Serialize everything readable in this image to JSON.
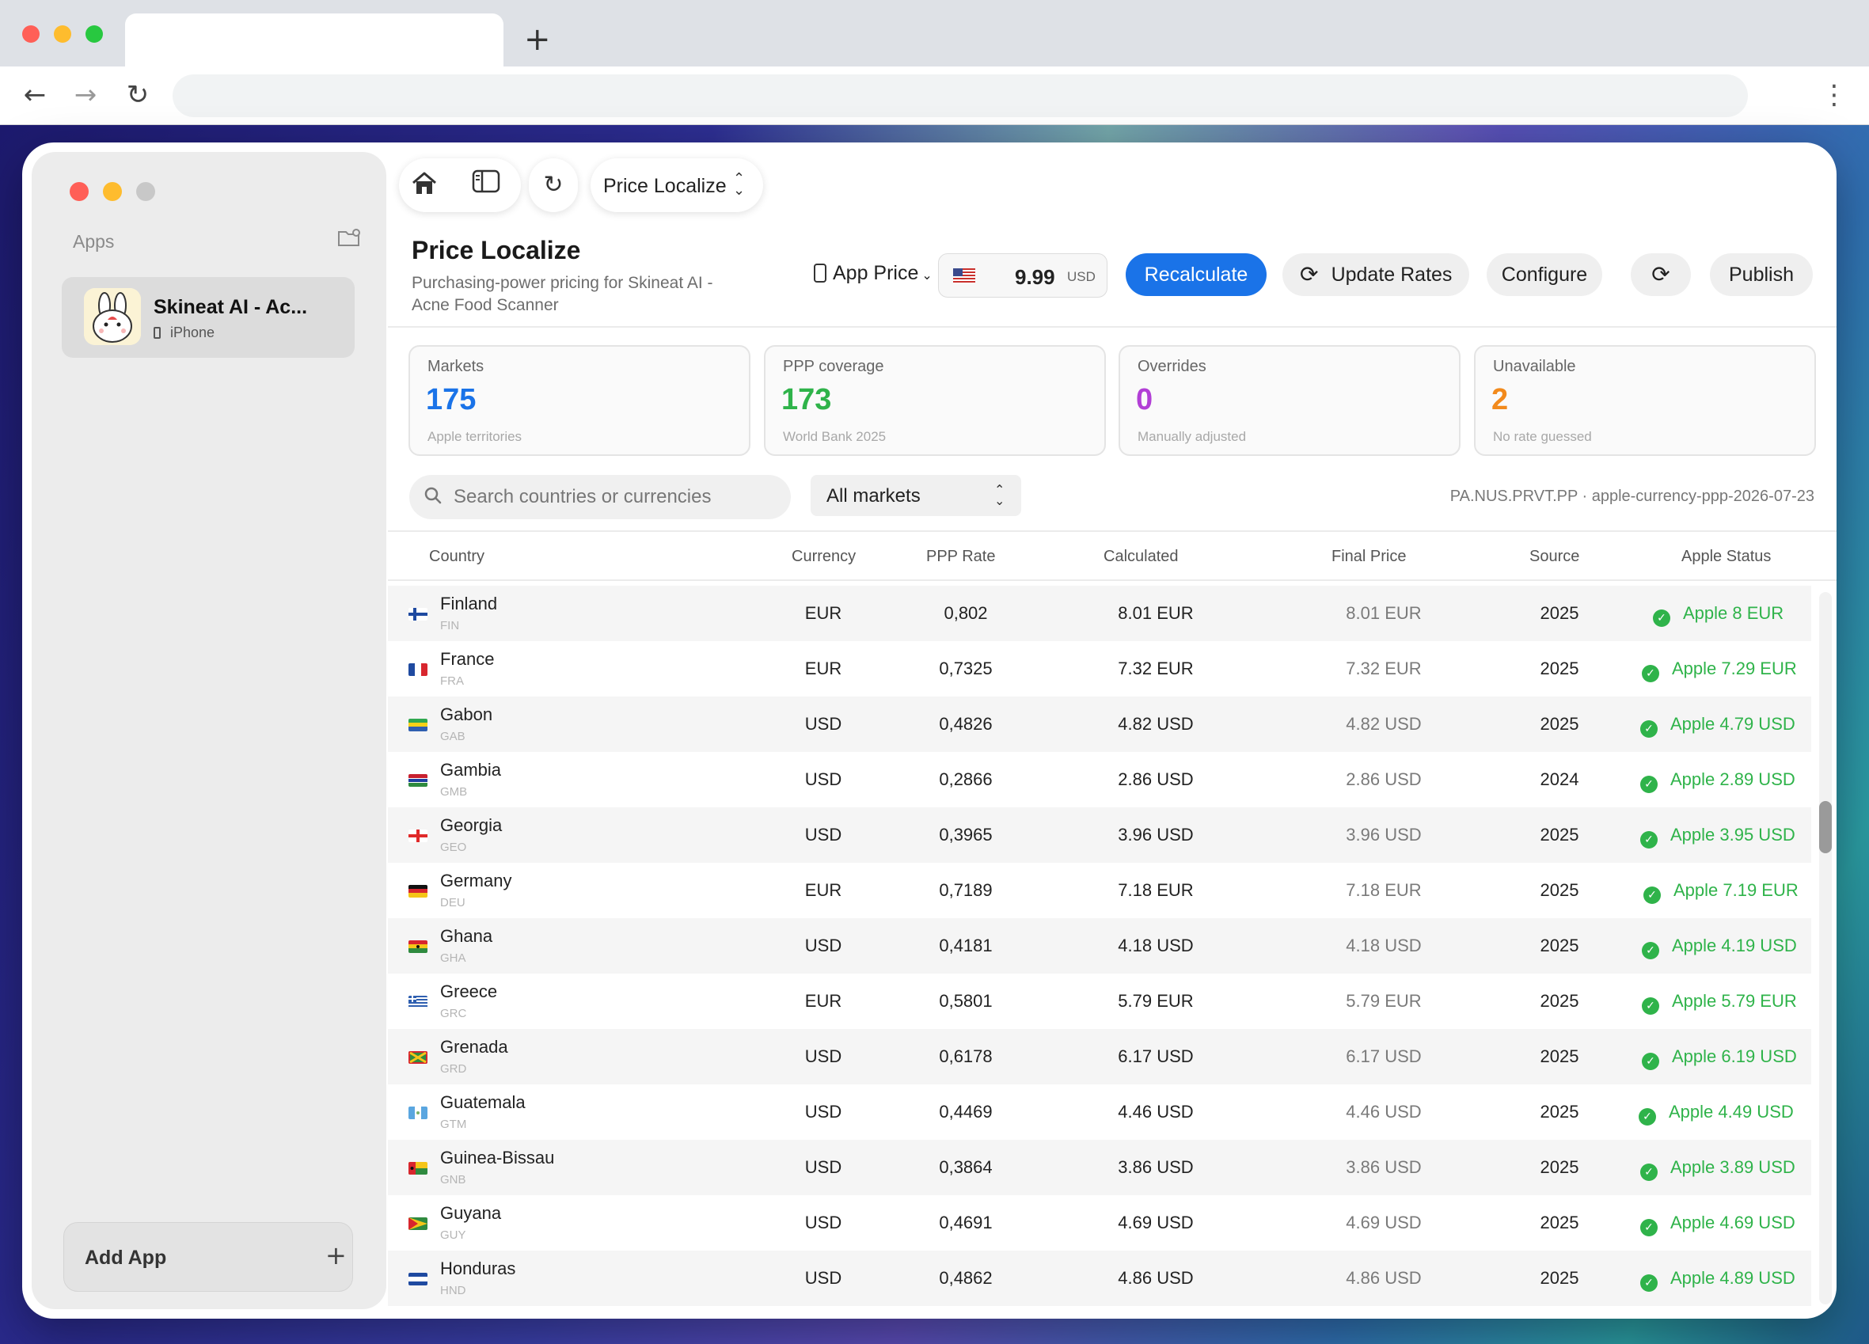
{
  "browser": {
    "new_tab": "+"
  },
  "sidebar": {
    "apps_label": "Apps",
    "app": {
      "name": "Skineat AI - Ac...",
      "device": "iPhone"
    },
    "add_app_label": "Add App"
  },
  "toolbar": {
    "view_select": "Price Localize"
  },
  "header": {
    "title": "Price Localize",
    "subtitle": "Purchasing-power pricing for Skineat AI - Acne Food Scanner",
    "app_price_label": "App Price",
    "base_price": "9.99",
    "base_currency": "USD",
    "recalculate": "Recalculate",
    "update_rates": "Update Rates",
    "configure": "Configure",
    "publish": "Publish"
  },
  "stats": [
    {
      "label": "Markets",
      "value": "175",
      "sub": "Apple territories",
      "color": "#1a73e8"
    },
    {
      "label": "PPP coverage",
      "value": "173",
      "sub": "World Bank 2025",
      "color": "#2fb34a"
    },
    {
      "label": "Overrides",
      "value": "0",
      "sub": "Manually adjusted",
      "color": "#b23fd6"
    },
    {
      "label": "Unavailable",
      "value": "2",
      "sub": "No rate guessed",
      "color": "#f28a1c"
    }
  ],
  "search": {
    "placeholder": "Search countries or currencies"
  },
  "filter": {
    "value": "All markets"
  },
  "source_meta": "PA.NUS.PRVT.PP · apple-currency-ppp-2026-07-23",
  "table": {
    "columns": [
      "Country",
      "Currency",
      "PPP Rate",
      "Calculated",
      "Final Price",
      "Source",
      "Apple Status"
    ],
    "rows": [
      {
        "country": "Finland",
        "code": "FIN",
        "currency": "EUR",
        "ppp": "0,802",
        "calculated": "8.01 EUR",
        "final": "8.01 EUR",
        "source": "2025",
        "status": "Apple 8 EUR"
      },
      {
        "country": "France",
        "code": "FRA",
        "currency": "EUR",
        "ppp": "0,7325",
        "calculated": "7.32 EUR",
        "final": "7.32 EUR",
        "source": "2025",
        "status": "Apple 7.29 EUR"
      },
      {
        "country": "Gabon",
        "code": "GAB",
        "currency": "USD",
        "ppp": "0,4826",
        "calculated": "4.82 USD",
        "final": "4.82 USD",
        "source": "2025",
        "status": "Apple 4.79 USD"
      },
      {
        "country": "Gambia",
        "code": "GMB",
        "currency": "USD",
        "ppp": "0,2866",
        "calculated": "2.86 USD",
        "final": "2.86 USD",
        "source": "2024",
        "status": "Apple 2.89 USD"
      },
      {
        "country": "Georgia",
        "code": "GEO",
        "currency": "USD",
        "ppp": "0,3965",
        "calculated": "3.96 USD",
        "final": "3.96 USD",
        "source": "2025",
        "status": "Apple 3.95 USD"
      },
      {
        "country": "Germany",
        "code": "DEU",
        "currency": "EUR",
        "ppp": "0,7189",
        "calculated": "7.18 EUR",
        "final": "7.18 EUR",
        "source": "2025",
        "status": "Apple 7.19 EUR"
      },
      {
        "country": "Ghana",
        "code": "GHA",
        "currency": "USD",
        "ppp": "0,4181",
        "calculated": "4.18 USD",
        "final": "4.18 USD",
        "source": "2025",
        "status": "Apple 4.19 USD"
      },
      {
        "country": "Greece",
        "code": "GRC",
        "currency": "EUR",
        "ppp": "0,5801",
        "calculated": "5.79 EUR",
        "final": "5.79 EUR",
        "source": "2025",
        "status": "Apple 5.79 EUR"
      },
      {
        "country": "Grenada",
        "code": "GRD",
        "currency": "USD",
        "ppp": "0,6178",
        "calculated": "6.17 USD",
        "final": "6.17 USD",
        "source": "2025",
        "status": "Apple 6.19 USD"
      },
      {
        "country": "Guatemala",
        "code": "GTM",
        "currency": "USD",
        "ppp": "0,4469",
        "calculated": "4.46 USD",
        "final": "4.46 USD",
        "source": "2025",
        "status": "Apple 4.49 USD"
      },
      {
        "country": "Guinea-Bissau",
        "code": "GNB",
        "currency": "USD",
        "ppp": "0,3864",
        "calculated": "3.86 USD",
        "final": "3.86 USD",
        "source": "2025",
        "status": "Apple 3.89 USD"
      },
      {
        "country": "Guyana",
        "code": "GUY",
        "currency": "USD",
        "ppp": "0,4691",
        "calculated": "4.69 USD",
        "final": "4.69 USD",
        "source": "2025",
        "status": "Apple 4.69 USD"
      },
      {
        "country": "Honduras",
        "code": "HND",
        "currency": "USD",
        "ppp": "0,4862",
        "calculated": "4.86 USD",
        "final": "4.86 USD",
        "source": "2025",
        "status": "Apple 4.89 USD"
      }
    ]
  },
  "colors": {
    "accent": "#1a73e8",
    "success": "#2fb34a"
  }
}
